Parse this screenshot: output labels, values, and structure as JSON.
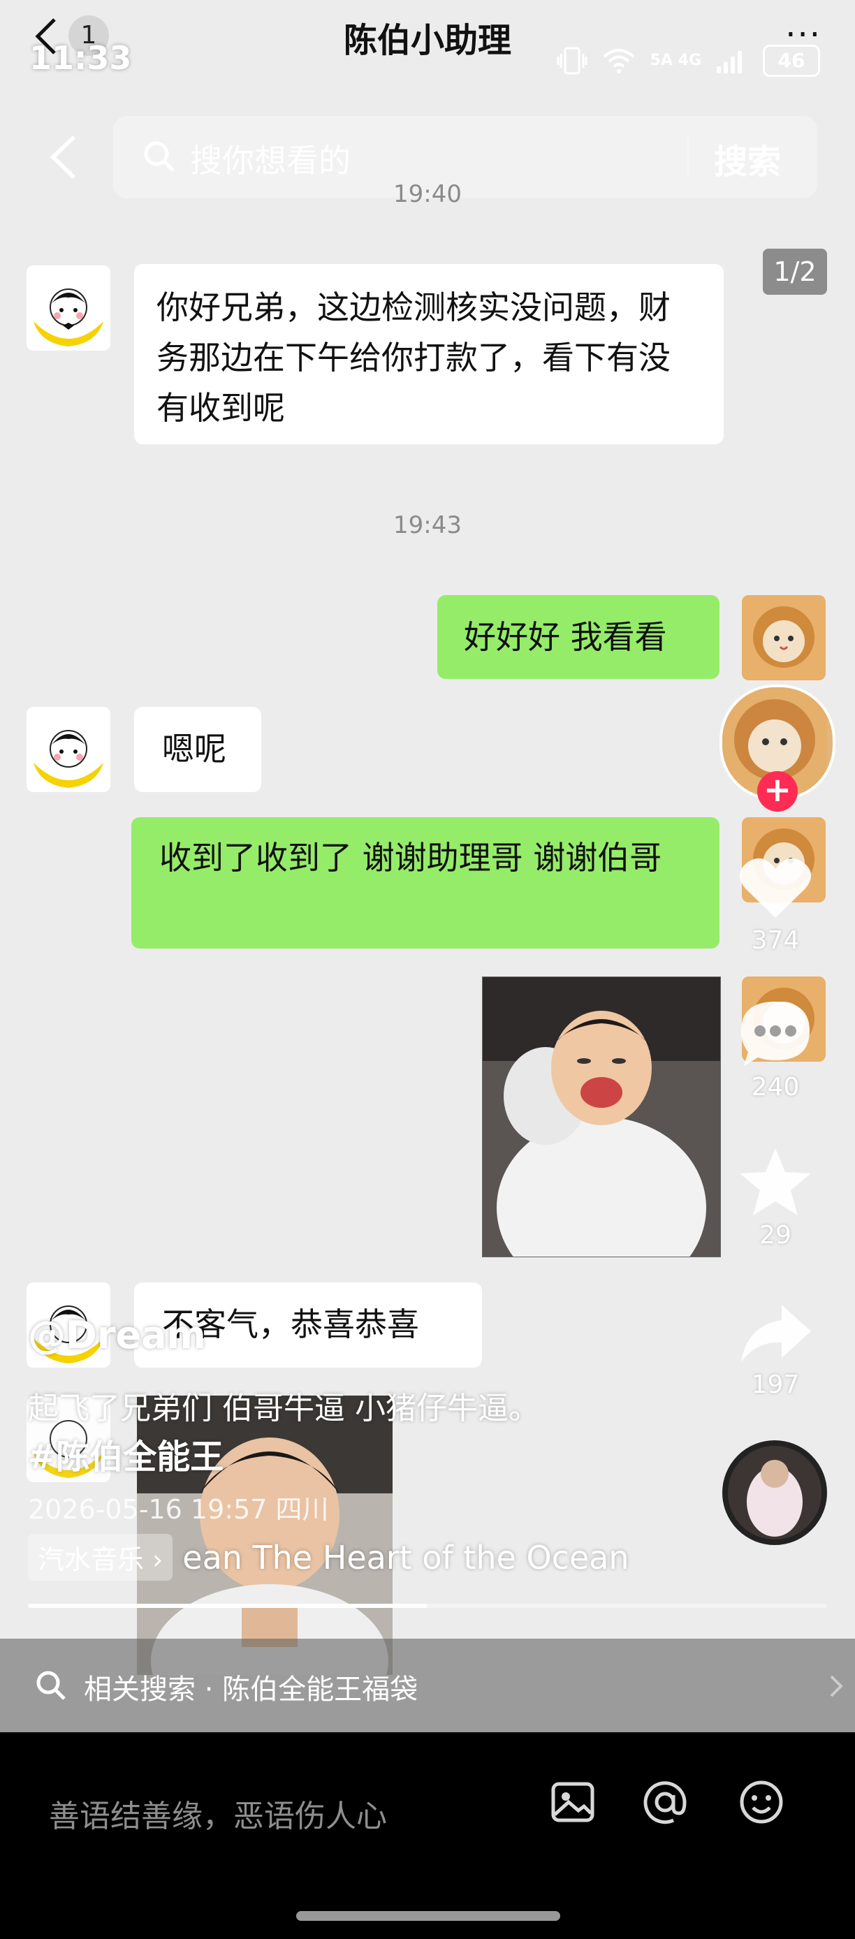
{
  "status_bar": {
    "time": "11:33",
    "network": "5A 4G",
    "battery": "46"
  },
  "chat": {
    "title": "陈伯小助理",
    "unread_count": "1",
    "more_label": "···",
    "timestamps": [
      "19:40",
      "19:43"
    ],
    "messages": [
      {
        "side": "in",
        "text": "你好兄弟，这边检测核实没问题，财务那边在下午给你打款了，看下有没有收到呢"
      },
      {
        "side": "out",
        "text": "好好好 我看看"
      },
      {
        "side": "in",
        "text": "嗯呢"
      },
      {
        "side": "out",
        "text": "收到了收到了 谢谢助理哥 谢谢伯哥"
      },
      {
        "side": "in",
        "text": "不客气，恭喜恭喜"
      }
    ]
  },
  "douyin": {
    "search": {
      "placeholder": "搜你想看的",
      "button": "搜索"
    },
    "page_indicator": "1/2",
    "likes": "374",
    "comments": "240",
    "favorites": "29",
    "shares": "197",
    "author": "@Dream",
    "caption": "起飞了兄弟们 伯哥牛逼 小猪仔牛逼。",
    "hashtag": "#陈伯全能王",
    "meta": "2026-05-16 19:57 四川",
    "music_tag": "汽水音乐 ›",
    "music_title": "ean  The Heart of the Ocean",
    "progress": 0.5,
    "related_search": "相关搜索 · 陈伯全能王福袋",
    "comment_placeholder": "善语结善缘，恶语伤人心"
  }
}
